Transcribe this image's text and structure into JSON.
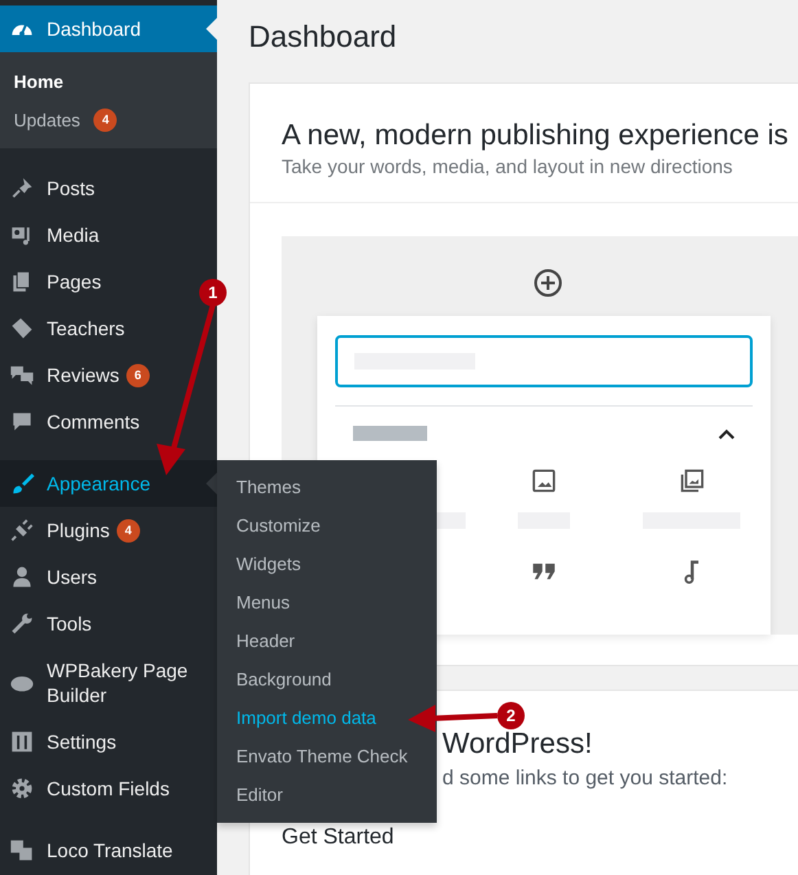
{
  "sidebar": {
    "top_item": {
      "label": "Dashboard",
      "selected": true
    },
    "submenu": [
      {
        "label": "Home",
        "current": true
      },
      {
        "label": "Updates",
        "current": false,
        "badge": "4"
      }
    ],
    "groups": [
      [
        {
          "label": "Posts",
          "hover": false
        },
        {
          "label": "Media",
          "hover": false
        },
        {
          "label": "Pages",
          "hover": false
        },
        {
          "label": "Teachers",
          "hover": false
        },
        {
          "label": "Reviews",
          "hover": false,
          "badge": "6"
        },
        {
          "label": "Comments",
          "hover": false
        }
      ],
      [
        {
          "label": "Appearance",
          "hover": true
        },
        {
          "label": "Plugins",
          "hover": false,
          "badge": "4"
        },
        {
          "label": "Users",
          "hover": false
        },
        {
          "label": "Tools",
          "hover": false
        },
        {
          "label": "WPBakery Page Builder",
          "hover": false
        },
        {
          "label": "Settings",
          "hover": false
        },
        {
          "label": "Custom Fields",
          "hover": false
        }
      ],
      [
        {
          "label": "Loco Translate",
          "hover": false
        }
      ]
    ]
  },
  "flyout": [
    {
      "label": "Themes",
      "selected": false
    },
    {
      "label": "Customize",
      "selected": false
    },
    {
      "label": "Widgets",
      "selected": false
    },
    {
      "label": "Menus",
      "selected": false
    },
    {
      "label": "Header",
      "selected": false
    },
    {
      "label": "Background",
      "selected": false
    },
    {
      "label": "Import demo data",
      "selected": true
    },
    {
      "label": "Envato Theme Check",
      "selected": false
    },
    {
      "label": "Editor",
      "selected": false
    }
  ],
  "main": {
    "title": "Dashboard",
    "welcome": {
      "heading": "A new, modern publishing experience is",
      "subheading": "Take your words, media, and layout in new directions"
    },
    "second_panel": {
      "heading": "WordPress!",
      "text": "d some links to get you started:",
      "section": "Get Started"
    }
  },
  "annotations": [
    {
      "number": "1"
    },
    {
      "number": "2"
    }
  ]
}
